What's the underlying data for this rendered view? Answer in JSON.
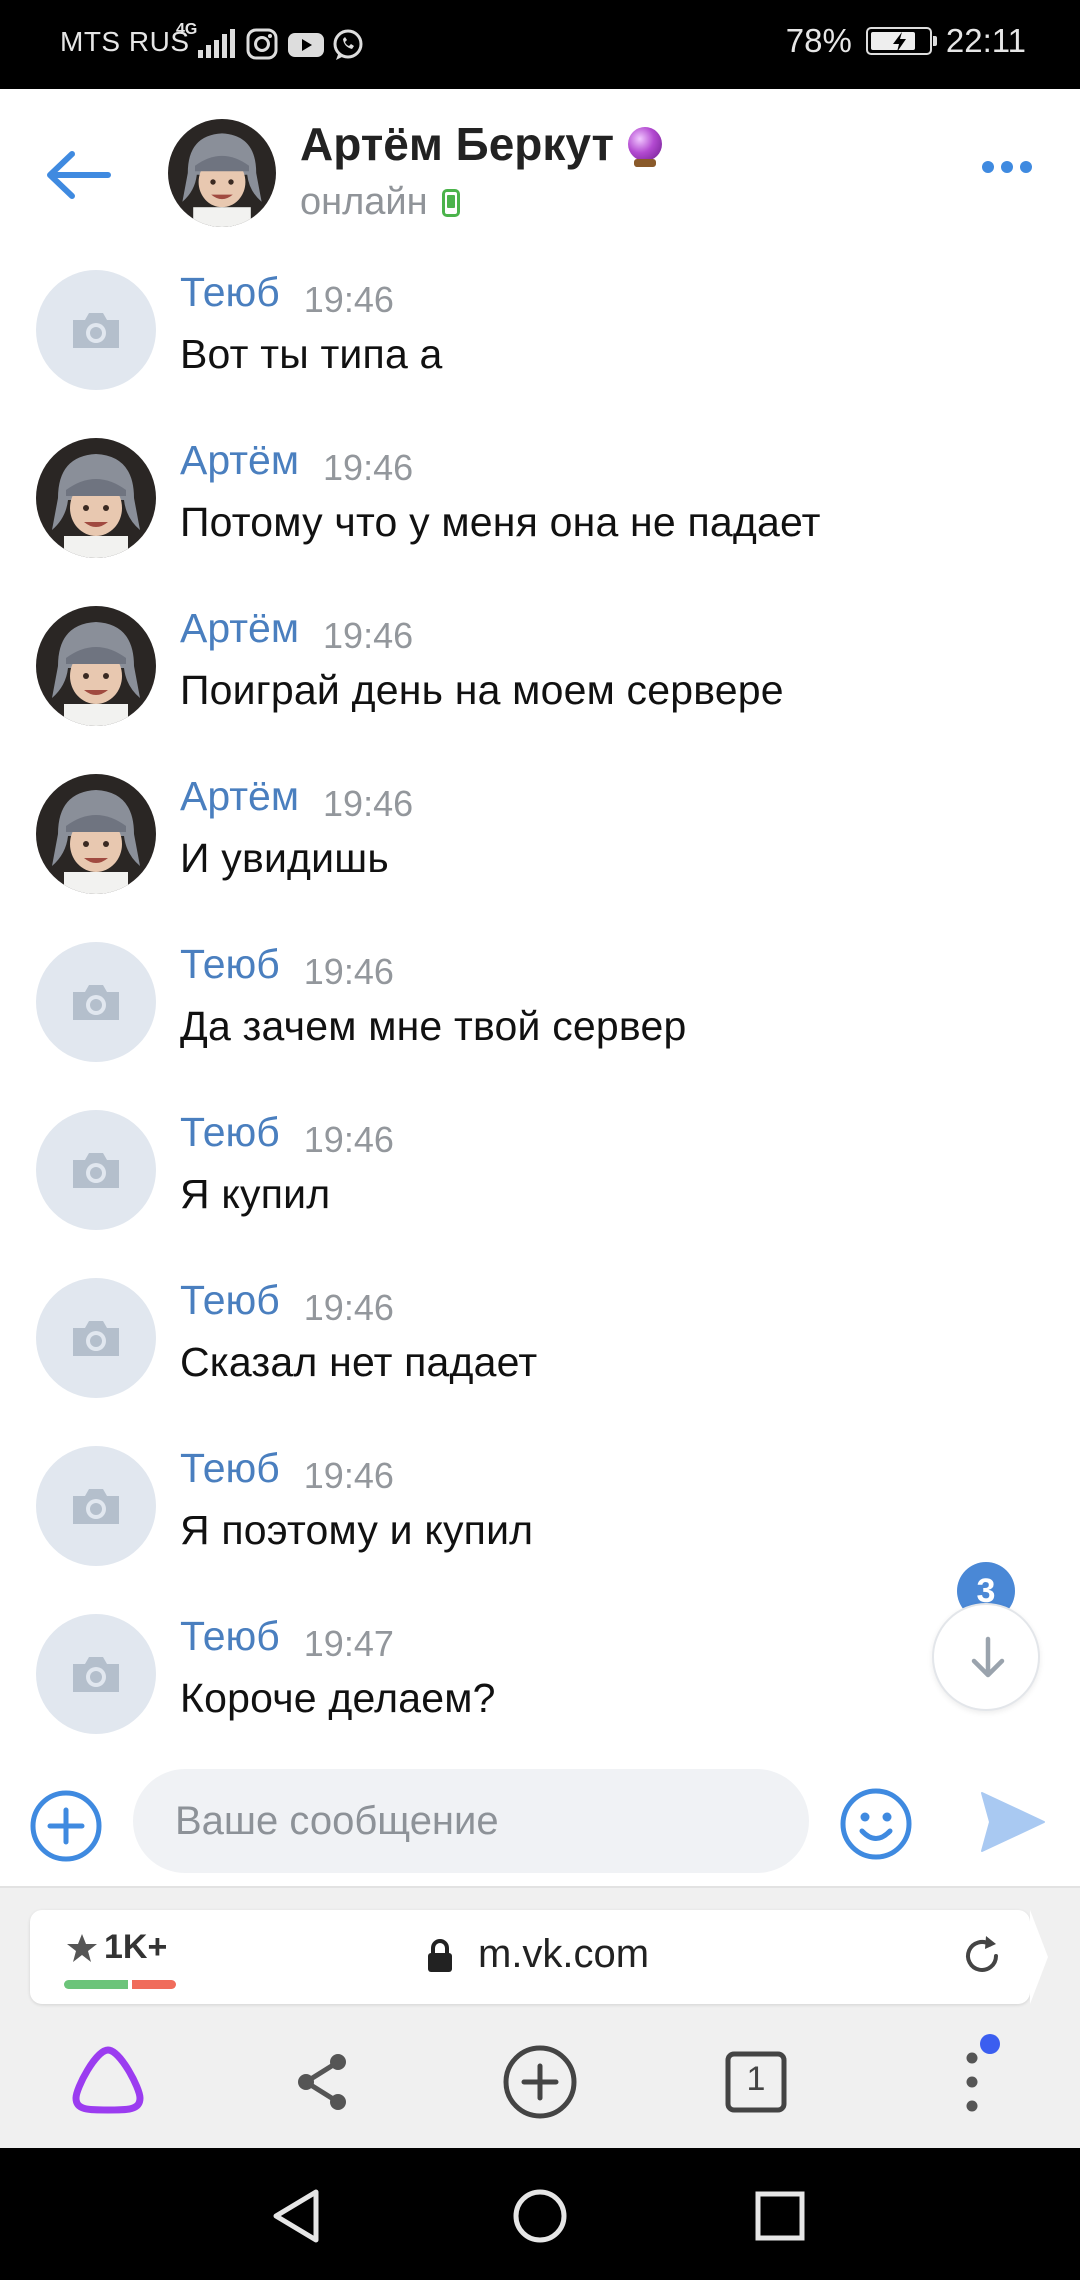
{
  "status_bar": {
    "carrier": "MTS RUS",
    "network": "4G",
    "battery": "78%",
    "battery_level": 0.78,
    "time": "22:11",
    "app_icons": [
      "instagram-icon",
      "youtube-icon",
      "whatsapp-icon"
    ]
  },
  "header": {
    "name": "Артём Беркут",
    "status": "онлайн",
    "badge_icon": "crystal-ball-icon",
    "status_icon": "mobile-icon"
  },
  "messages": [
    {
      "author": "Теюб",
      "time": "19:46",
      "text": "Вот ты типа а",
      "avatar": "placeholder"
    },
    {
      "author": "Артём",
      "time": "19:46",
      "text": "Потому что у меня она не падает",
      "avatar": "photo"
    },
    {
      "author": "Артём",
      "time": "19:46",
      "text": "Поиграй день на моем сервере",
      "avatar": "photo"
    },
    {
      "author": "Артём",
      "time": "19:46",
      "text": "И увидишь",
      "avatar": "photo"
    },
    {
      "author": "Теюб",
      "time": "19:46",
      "text": "Да зачем мне твой сервер",
      "avatar": "placeholder"
    },
    {
      "author": "Теюб",
      "time": "19:46",
      "text": "Я купил",
      "avatar": "placeholder"
    },
    {
      "author": "Теюб",
      "time": "19:46",
      "text": "Сказал нет падает",
      "avatar": "placeholder"
    },
    {
      "author": "Теюб",
      "time": "19:46",
      "text": "Я поэтому и купил",
      "avatar": "placeholder"
    },
    {
      "author": "Теюб",
      "time": "19:47",
      "text": "Короче делаем?",
      "avatar": "placeholder"
    }
  ],
  "scroll_badge": "3",
  "composer": {
    "placeholder": "Ваше сообщение"
  },
  "browser": {
    "rating": "1K+",
    "url": "m.vk.com",
    "tabs_count": "1"
  },
  "colors": {
    "accent": "#3f8ae0",
    "author": "#4a7fbf",
    "online": "#4bb34b",
    "badge": "#4a88d6",
    "alice": "#9b3cf0"
  }
}
